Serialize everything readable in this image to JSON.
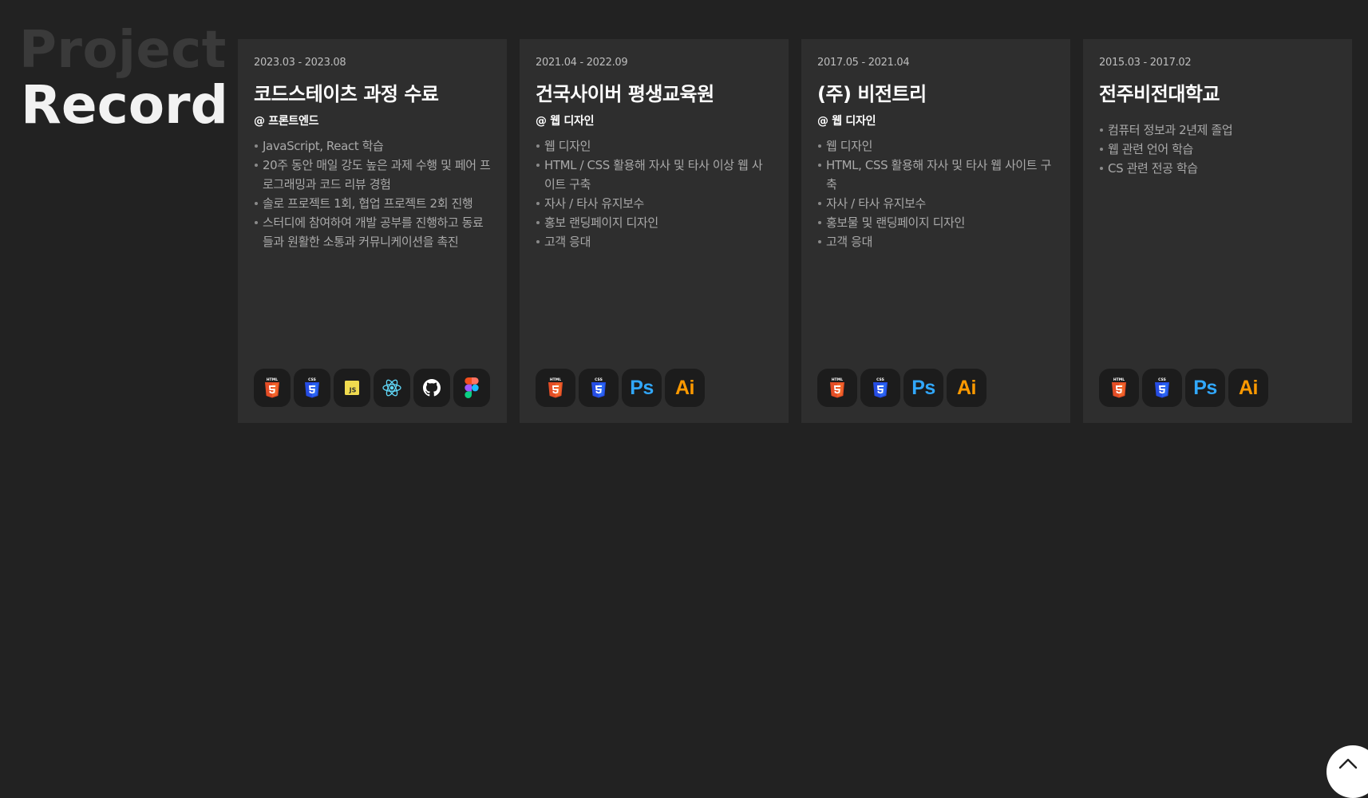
{
  "heading": {
    "line1": "Project",
    "line2": "Record"
  },
  "colors": {
    "background": "#222222",
    "card": "#2e2e2e",
    "icon_bg": "#1c1c1c",
    "html": "#e44d26",
    "css": "#264de4",
    "js": "#f0db4f",
    "react": "#61dafb",
    "ps": "#31a8ff",
    "ai": "#ff9a00"
  },
  "cards": [
    {
      "period": "2023.03 - 2023.08",
      "title": "코드스테이츠 과정 수료",
      "role": "@ 프론트엔드",
      "bullets": [
        "JavaScript, React 학습",
        "20주 동안 매일 강도 높은 과제 수행 및 페어 프로그래밍과 코드 리뷰 경험",
        "솔로 프로젝트 1회, 협업 프로젝트 2회 진행",
        "스터디에 참여하여 개발 공부를 진행하고 동료들과 원활한 소통과 커뮤니케이션을 촉진"
      ],
      "tech": [
        "html5-icon",
        "css3-icon",
        "javascript-icon",
        "react-icon",
        "github-icon",
        "figma-icon"
      ]
    },
    {
      "period": "2021.04 - 2022.09",
      "title": "건국사이버 평생교육원",
      "role": "@ 웹 디자인",
      "bullets": [
        "웹 디자인",
        "HTML / CSS 활용해 자사 및 타사 이상 웹 사이트 구축",
        "자사 / 타사 유지보수",
        "홍보 랜딩페이지 디자인",
        "고객 응대"
      ],
      "tech": [
        "html5-icon",
        "css3-icon",
        "photoshop-icon",
        "illustrator-icon"
      ]
    },
    {
      "period": "2017.05 - 2021.04",
      "title": "(주) 비전트리",
      "role": "@ 웹 디자인",
      "bullets": [
        "웹 디자인",
        "HTML, CSS 활용해 자사 및 타사 웹 사이트 구축",
        "자사 / 타사 유지보수",
        "홍보물 및 랜딩페이지 디자인",
        "고객 응대"
      ],
      "tech": [
        "html5-icon",
        "css3-icon",
        "photoshop-icon",
        "illustrator-icon"
      ]
    },
    {
      "period": "2015.03 - 2017.02",
      "title": "전주비전대학교",
      "role": "",
      "bullets": [
        "컴퓨터 정보과 2년제 졸업",
        "웹 관련 언어 학습",
        "CS 관련 전공 학습"
      ],
      "tech": [
        "html5-icon",
        "css3-icon",
        "photoshop-icon",
        "illustrator-icon"
      ]
    }
  ],
  "tech_text": {
    "ps": "Ps",
    "ai": "Ai",
    "js": "JS",
    "html": "HTML",
    "css": "CSS"
  },
  "scroll_top_icon": "chevron-up-icon"
}
